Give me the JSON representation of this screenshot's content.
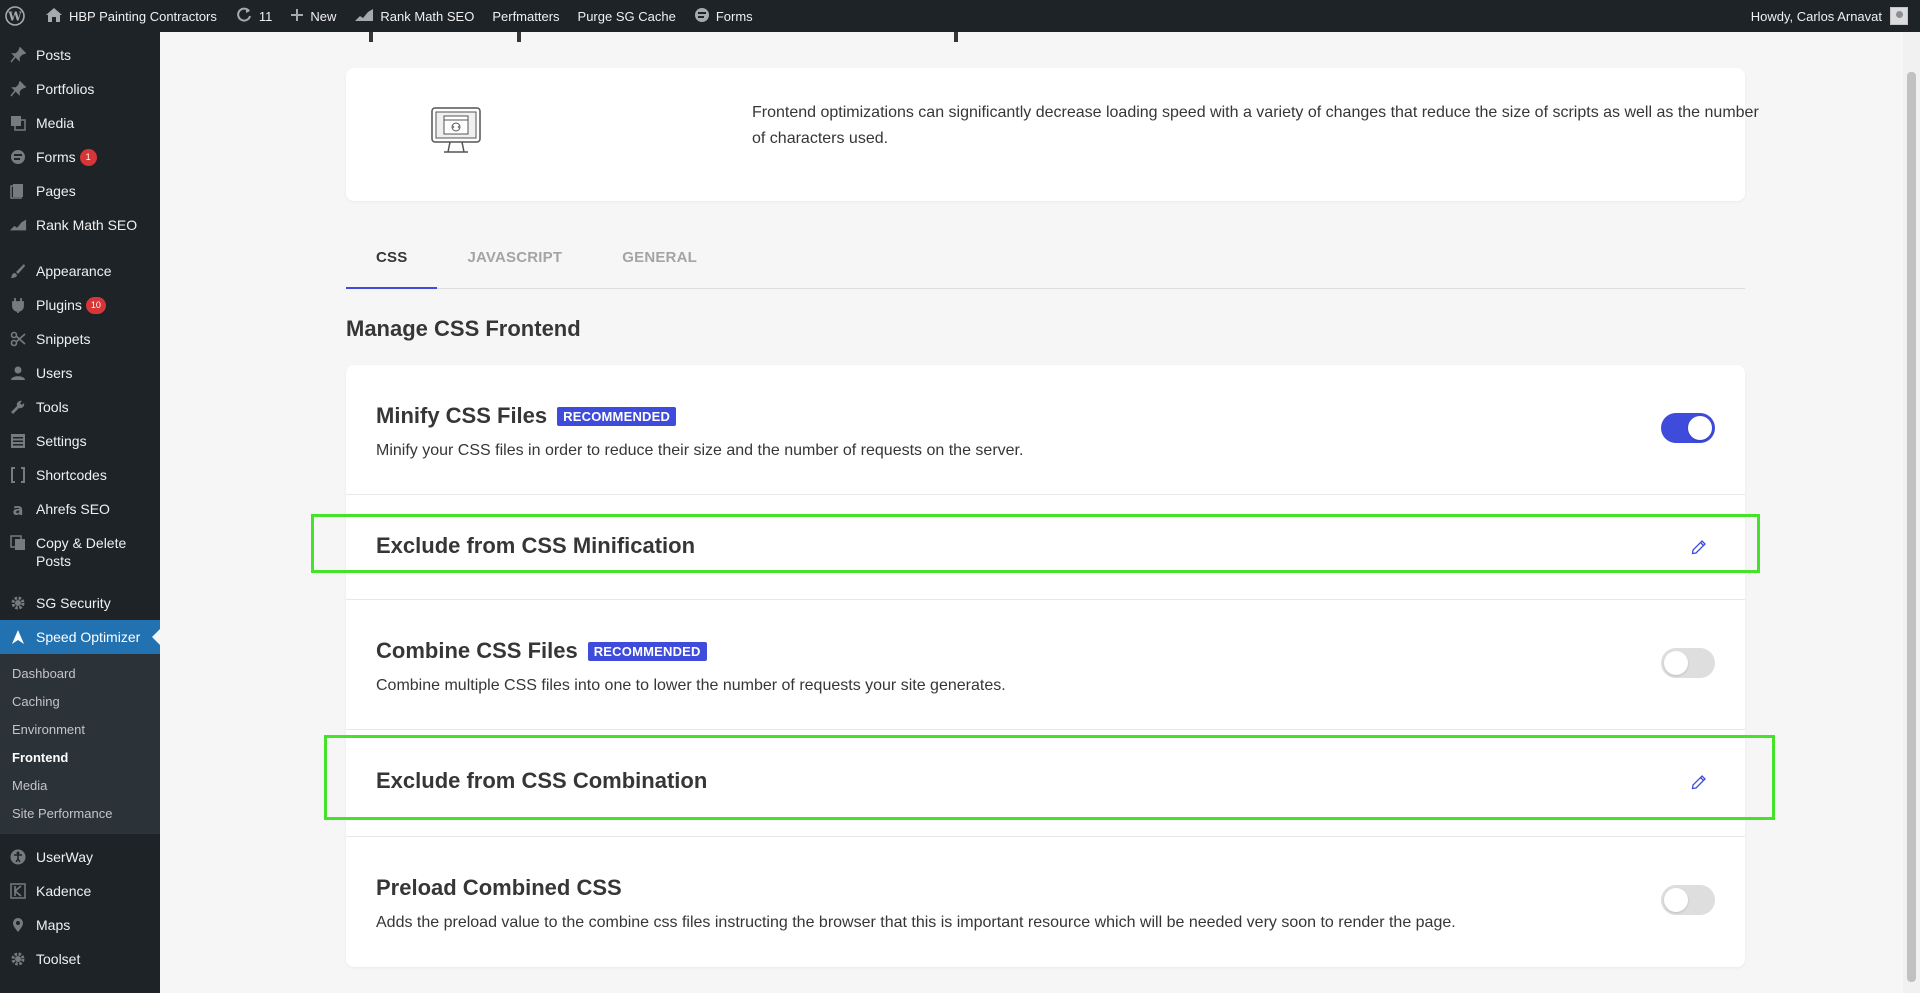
{
  "admin_bar": {
    "site_name": "HBP Painting Contractors",
    "updates_count": "11",
    "new_label": "New",
    "rank_math": "Rank Math SEO",
    "perfmatters": "Perfmatters",
    "purge": "Purge SG Cache",
    "forms": "Forms",
    "howdy": "Howdy, Carlos Arnavat"
  },
  "sidebar": {
    "items": [
      {
        "label": "Posts",
        "icon": "pin-icon"
      },
      {
        "label": "Portfolios",
        "icon": "pin-icon"
      },
      {
        "label": "Media",
        "icon": "media-icon"
      },
      {
        "label": "Forms",
        "icon": "forms-icon",
        "badge": "1"
      },
      {
        "label": "Pages",
        "icon": "pages-icon"
      },
      {
        "label": "Rank Math SEO",
        "icon": "rankmath-icon"
      },
      {
        "label": "Appearance",
        "icon": "brush-icon"
      },
      {
        "label": "Plugins",
        "icon": "plugin-icon",
        "badge": "10"
      },
      {
        "label": "Snippets",
        "icon": "scissors-icon"
      },
      {
        "label": "Users",
        "icon": "user-icon"
      },
      {
        "label": "Tools",
        "icon": "wrench-icon"
      },
      {
        "label": "Settings",
        "icon": "settings-icon"
      },
      {
        "label": "Shortcodes",
        "icon": "brackets-icon"
      },
      {
        "label": "Ahrefs SEO",
        "icon": "ahrefs-icon"
      },
      {
        "label": "Copy & Delete Posts",
        "icon": "copy-icon"
      },
      {
        "label": "SG Security",
        "icon": "gear-icon"
      },
      {
        "label": "Speed Optimizer",
        "icon": "speed-icon"
      },
      {
        "label": "UserWay",
        "icon": "accessibility-icon"
      },
      {
        "label": "Kadence",
        "icon": "kadence-icon"
      },
      {
        "label": "Maps",
        "icon": "map-pin-icon"
      },
      {
        "label": "Toolset",
        "icon": "gear-icon"
      }
    ],
    "submenu": [
      "Dashboard",
      "Caching",
      "Environment",
      "Frontend",
      "Media",
      "Site Performance"
    ]
  },
  "intro": {
    "text": "Frontend optimizations can significantly decrease loading speed with a variety of changes that reduce the size of scripts as well as the number of characters used."
  },
  "tabs": [
    "CSS",
    "JAVASCRIPT",
    "GENERAL"
  ],
  "section_title": "Manage CSS Frontend",
  "settings": {
    "minify_title": "Minify CSS Files",
    "minify_badge": "RECOMMENDED",
    "minify_desc": "Minify your CSS files in order to reduce their size and the number of requests on the server.",
    "minify_enabled": true,
    "exclude_minify_title": "Exclude from CSS Minification",
    "combine_title": "Combine CSS Files",
    "combine_badge": "RECOMMENDED",
    "combine_desc": "Combine multiple CSS files into one to lower the number of requests your site generates.",
    "combine_enabled": false,
    "exclude_combine_title": "Exclude from CSS Combination",
    "preload_title": "Preload Combined CSS",
    "preload_desc": "Adds the preload value to the combine css files instructing the browser that this is important resource which will be needed very soon to render the page.",
    "preload_enabled": false
  },
  "colors": {
    "accent": "#3e4bdb",
    "highlight": "#44e32a",
    "wp_admin_bg": "#1d2327",
    "wp_current": "#2271b1"
  }
}
